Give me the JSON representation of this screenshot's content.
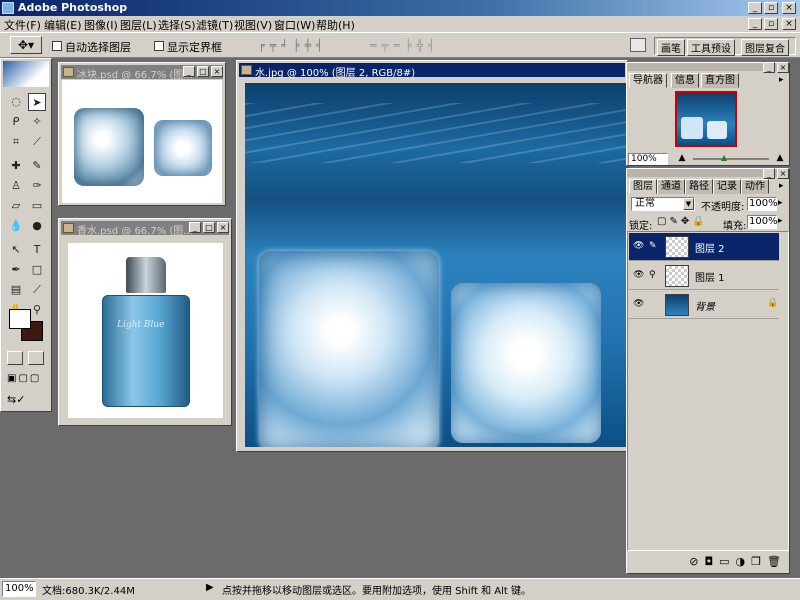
{
  "app": {
    "title": "Adobe Photoshop"
  },
  "menu": [
    "文件(F)",
    "编辑(E)",
    "图像(I)",
    "图层(L)",
    "选择(S)",
    "滤镜(T)",
    "视图(V)",
    "窗口(W)",
    "帮助(H)"
  ],
  "options": {
    "auto_select": "自动选择图层",
    "show_bounds": "显示定界框",
    "palette_tabs": [
      "画笔",
      "工具预设",
      "图层复合"
    ]
  },
  "docs": {
    "ice": {
      "title": "冰块.psd @ 66.7% (图..."
    },
    "perfume": {
      "title": "香水.psd @ 66.7% (图..."
    },
    "water": {
      "title": "水.jpg @ 100% (图层 2, RGB/8#)"
    },
    "perfume_label": "Light Blue"
  },
  "navigator": {
    "tabs": [
      "导航器",
      "信息",
      "直方图"
    ],
    "zoom": "100%"
  },
  "layers": {
    "tabs": [
      "图层",
      "通道",
      "路径",
      "记录",
      "动作"
    ],
    "blend_mode": "正常",
    "opacity_label": "不透明度:",
    "opacity": "100%",
    "lock_label": "锁定:",
    "fill_label": "填充:",
    "fill": "100%",
    "items": [
      {
        "name": "图层 2",
        "selected": true
      },
      {
        "name": "图层 1",
        "selected": false
      },
      {
        "name": "背景",
        "selected": false
      }
    ]
  },
  "status": {
    "zoom": "100%",
    "doc": "文档:680.3K/2.44M",
    "hint": "点按并拖移以移动图层或选区。要用附加选项，使用 Shift 和 Alt 键。"
  },
  "colors": {
    "title_active": "#0a246a",
    "ui_face": "#d4d0c8",
    "workspace": "#6b6b6b",
    "water_deep": "#0b4f86"
  }
}
